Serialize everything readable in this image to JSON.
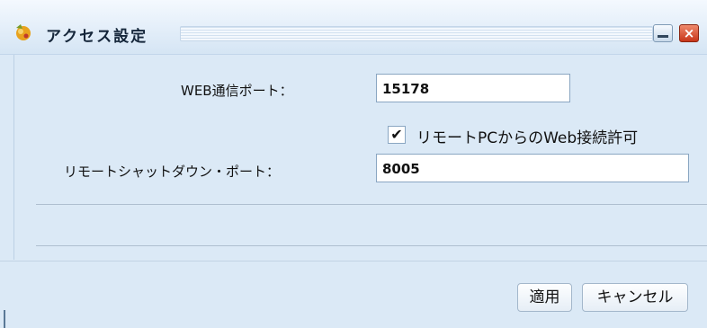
{
  "window": {
    "title": "アクセス設定",
    "icon": "app-icon"
  },
  "form": {
    "web_port_label": "WEB通信ポート：",
    "web_port_value": "15178",
    "remote_web_checkbox_label": "リモートPCからのWeb接続許可",
    "remote_web_checked": true,
    "shutdown_port_label": "リモートシャットダウン・ポート：",
    "shutdown_port_value": "8005"
  },
  "buttons": {
    "apply": "適用",
    "cancel": "キャンセル"
  }
}
